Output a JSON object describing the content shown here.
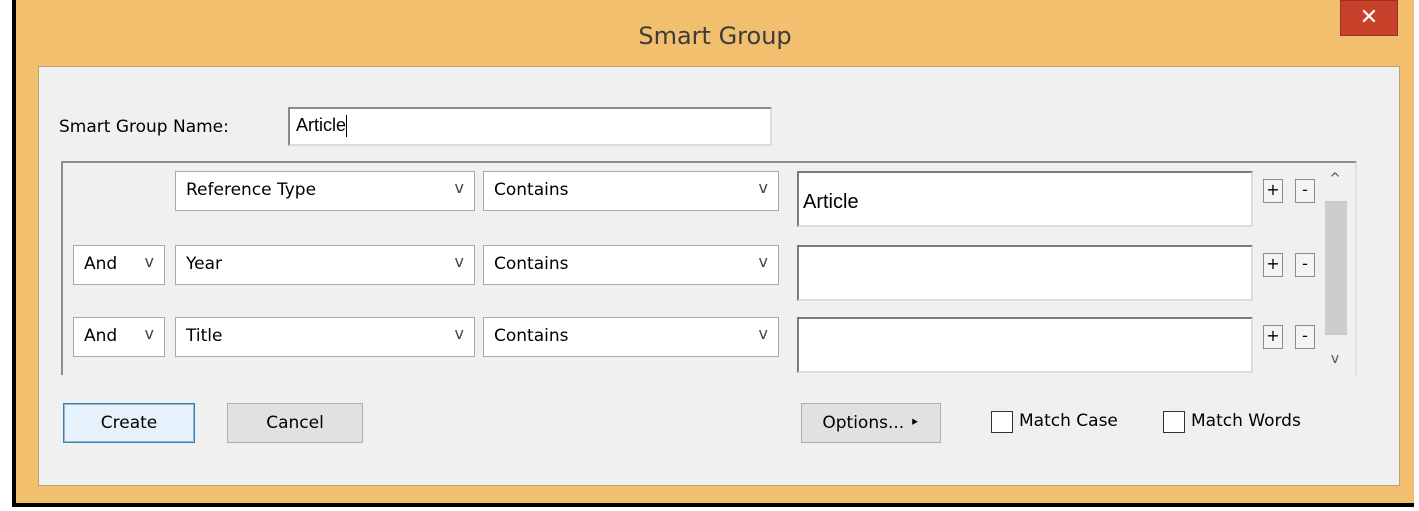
{
  "window": {
    "title": "Smart Group",
    "close_label": "✕"
  },
  "name_field": {
    "label": "Smart Group Name:",
    "value": "Article"
  },
  "criteria": [
    {
      "connector": "",
      "field": "Reference Type",
      "operator": "Contains",
      "value": "Article"
    },
    {
      "connector": "And",
      "field": "Year",
      "operator": "Contains",
      "value": ""
    },
    {
      "connector": "And",
      "field": "Title",
      "operator": "Contains",
      "value": ""
    }
  ],
  "row_buttons": {
    "add": "+",
    "remove": "-"
  },
  "scroll": {
    "up": "^",
    "down": "v"
  },
  "combo_arrow": "v",
  "buttons": {
    "create": "Create",
    "cancel": "Cancel",
    "options": "Options... ‣"
  },
  "checkboxes": {
    "match_case": "Match Case",
    "match_words": "Match Words"
  }
}
